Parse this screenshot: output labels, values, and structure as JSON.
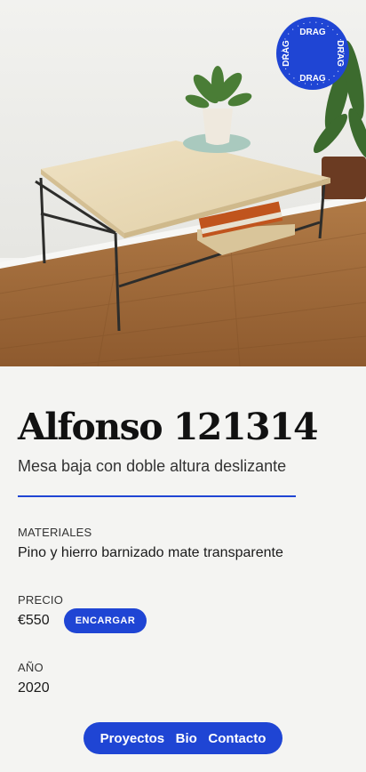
{
  "hero": {
    "image_alt": "Mesa baja de pino y hierro sobre suelo de madera"
  },
  "drag_badge": {
    "label": "DRAG"
  },
  "product": {
    "title": "Alfonso 121314",
    "subtitle": "Mesa baja con doble altura deslizante"
  },
  "details": {
    "materials_label": "MATERIALES",
    "materials_value": "Pino y hierro barnizado mate transparente",
    "price_label": "PRECIO",
    "price_value": "€550",
    "order_button": "ENCARGAR",
    "year_label": "AÑO",
    "year_value": "2020"
  },
  "nav": {
    "items": [
      "Proyectos",
      "Bio",
      "Contacto"
    ]
  },
  "colors": {
    "accent": "#1f45d4",
    "background": "#f4f4f2"
  }
}
